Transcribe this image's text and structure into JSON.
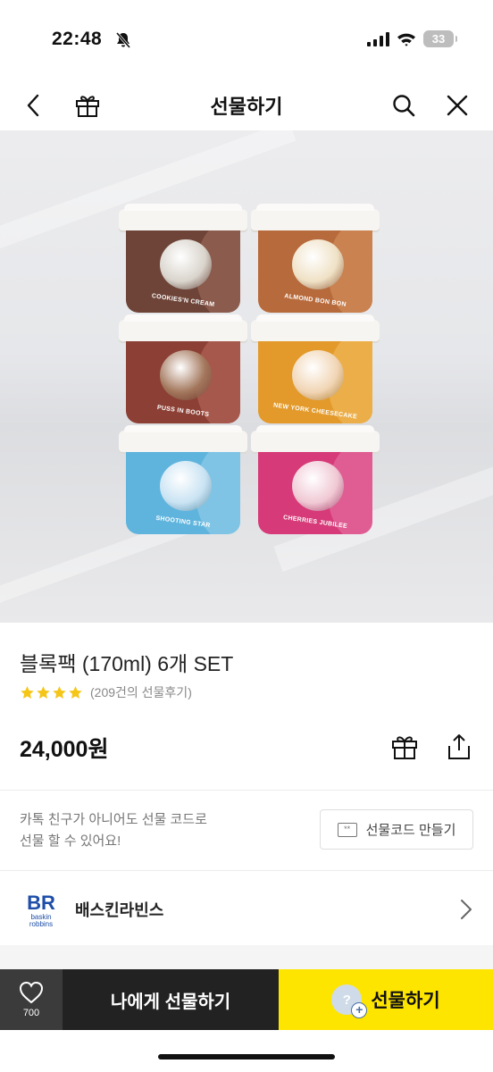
{
  "status_bar": {
    "time": "22:48",
    "battery": "33",
    "icons": [
      "bell-slash-icon",
      "signal-icon",
      "wifi-icon",
      "battery-icon"
    ]
  },
  "nav": {
    "title": "선물하기",
    "icons": [
      "back-icon",
      "gift-box-icon",
      "search-icon",
      "close-icon"
    ]
  },
  "hero": {
    "cups": [
      {
        "label": "COOKIES'N CREAM",
        "body": "#6e4438",
        "swirl": "#b07a68",
        "scoop": "#d9d4cc"
      },
      {
        "label": "ALMOND BON BON",
        "body": "#b76a3b",
        "swirl": "#e0a06a",
        "scoop": "#efe1c5"
      },
      {
        "label": "PUSS IN BOOTS",
        "body": "#8c3f34",
        "swirl": "#c8786a",
        "scoop": "#a3775c"
      },
      {
        "label": "NEW YORK CHEESECAKE",
        "body": "#e39a2a",
        "swirl": "#f6c86e",
        "scoop": "#f1d5b4"
      },
      {
        "label": "SHOOTING STAR",
        "body": "#5fb4dd",
        "swirl": "#a9d8f0",
        "scoop": "#c9e3f3"
      },
      {
        "label": "CHERRIES JUBILEE",
        "body": "#d63a78",
        "swirl": "#ee8ab4",
        "scoop": "#f0c8d4"
      }
    ]
  },
  "product": {
    "title": "블록팩 (170ml) 6개 SET",
    "stars": 4,
    "review_text": "(209건의 선물후기)",
    "price": "24,000원",
    "star_color": "#f5c518"
  },
  "gift_code": {
    "info_line1": "카톡 친구가 아니어도 선물 코드로",
    "info_line2": "선물 할 수 있어요!",
    "button_label": "선물코드 만들기",
    "icon_text": "**"
  },
  "brand": {
    "name": "배스킨라빈스",
    "logo_text": "BR",
    "logo_sub1": "baskin",
    "logo_sub2": "robbins"
  },
  "bottom": {
    "like_count": "700",
    "self_gift_label": "나에게 선물하기",
    "gift_label": "선물하기",
    "gift_avatar_text": "?",
    "gift_avatar_plus": "+",
    "accent": "#fee500"
  }
}
